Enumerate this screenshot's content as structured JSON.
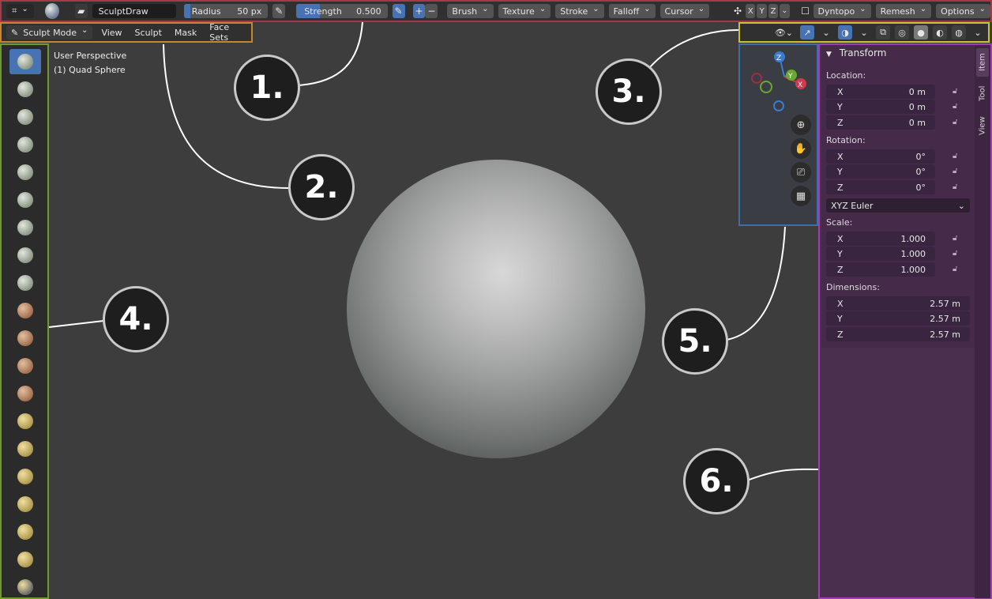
{
  "toolheader": {
    "brush_name": "SculptDraw",
    "radius_label": "Radius",
    "radius_value": "50 px",
    "strength_label": "Strength",
    "strength_value": "0.500",
    "strength_fraction": 0.5,
    "plus": "+",
    "minus": "−",
    "menus": [
      "Brush",
      "Texture",
      "Stroke",
      "Falloff",
      "Cursor"
    ],
    "axes": [
      "X",
      "Y",
      "Z"
    ],
    "dyntopo": "Dyntopo",
    "remesh": "Remesh",
    "options": "Options"
  },
  "modeheader": {
    "mode": "Sculpt Mode",
    "menus": [
      "View",
      "Sculpt",
      "Mask",
      "Face Sets"
    ]
  },
  "viewport": {
    "perspective": "User Perspective",
    "object": "(1) Quad Sphere"
  },
  "gizmo": {
    "axes": [
      "Z",
      "Y",
      "X"
    ]
  },
  "sidebar": {
    "panel_title": "Transform",
    "location_label": "Location:",
    "location": [
      {
        "axis": "X",
        "value": "0 m"
      },
      {
        "axis": "Y",
        "value": "0 m"
      },
      {
        "axis": "Z",
        "value": "0 m"
      }
    ],
    "rotation_label": "Rotation:",
    "rotation": [
      {
        "axis": "X",
        "value": "0°"
      },
      {
        "axis": "Y",
        "value": "0°"
      },
      {
        "axis": "Z",
        "value": "0°"
      }
    ],
    "rotation_mode": "XYZ Euler",
    "scale_label": "Scale:",
    "scale": [
      {
        "axis": "X",
        "value": "1.000"
      },
      {
        "axis": "Y",
        "value": "1.000"
      },
      {
        "axis": "Z",
        "value": "1.000"
      }
    ],
    "dimensions_label": "Dimensions:",
    "dimensions": [
      {
        "axis": "X",
        "value": "2.57 m"
      },
      {
        "axis": "Y",
        "value": "2.57 m"
      },
      {
        "axis": "Z",
        "value": "2.57 m"
      }
    ],
    "tabs": [
      "Item",
      "Tool",
      "View"
    ]
  },
  "callouts": [
    "1.",
    "2.",
    "3.",
    "4.",
    "5.",
    "6."
  ],
  "colors": {
    "toolheader_border": "#a23a4a",
    "modeheader_border": "#c8862a",
    "vpheader_border": "#c9c234",
    "toolbar_border": "#6d9a2e",
    "gizmo_border": "#3c6ea8",
    "sidebar_border": "#a23bb5",
    "accent": "#4772b3"
  }
}
